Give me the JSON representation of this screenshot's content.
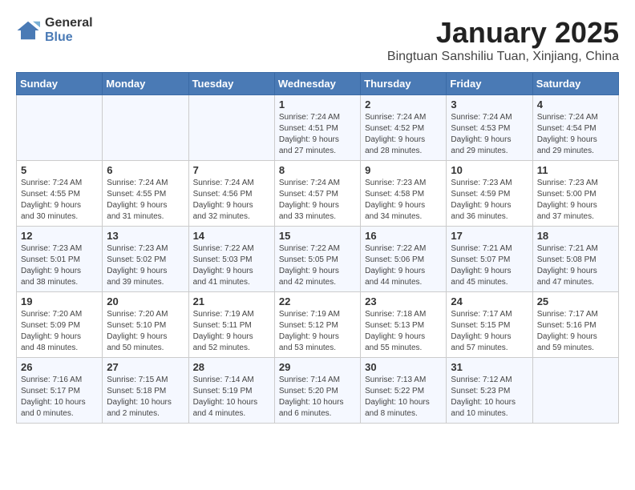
{
  "logo": {
    "general": "General",
    "blue": "Blue"
  },
  "header": {
    "title": "January 2025",
    "subtitle": "Bingtuan Sanshiliu Tuan, Xinjiang, China"
  },
  "days_of_week": [
    "Sunday",
    "Monday",
    "Tuesday",
    "Wednesday",
    "Thursday",
    "Friday",
    "Saturday"
  ],
  "weeks": [
    {
      "days": [
        {
          "number": "",
          "info": ""
        },
        {
          "number": "",
          "info": ""
        },
        {
          "number": "",
          "info": ""
        },
        {
          "number": "1",
          "info": "Sunrise: 7:24 AM\nSunset: 4:51 PM\nDaylight: 9 hours\nand 27 minutes."
        },
        {
          "number": "2",
          "info": "Sunrise: 7:24 AM\nSunset: 4:52 PM\nDaylight: 9 hours\nand 28 minutes."
        },
        {
          "number": "3",
          "info": "Sunrise: 7:24 AM\nSunset: 4:53 PM\nDaylight: 9 hours\nand 29 minutes."
        },
        {
          "number": "4",
          "info": "Sunrise: 7:24 AM\nSunset: 4:54 PM\nDaylight: 9 hours\nand 29 minutes."
        }
      ]
    },
    {
      "days": [
        {
          "number": "5",
          "info": "Sunrise: 7:24 AM\nSunset: 4:55 PM\nDaylight: 9 hours\nand 30 minutes."
        },
        {
          "number": "6",
          "info": "Sunrise: 7:24 AM\nSunset: 4:55 PM\nDaylight: 9 hours\nand 31 minutes."
        },
        {
          "number": "7",
          "info": "Sunrise: 7:24 AM\nSunset: 4:56 PM\nDaylight: 9 hours\nand 32 minutes."
        },
        {
          "number": "8",
          "info": "Sunrise: 7:24 AM\nSunset: 4:57 PM\nDaylight: 9 hours\nand 33 minutes."
        },
        {
          "number": "9",
          "info": "Sunrise: 7:23 AM\nSunset: 4:58 PM\nDaylight: 9 hours\nand 34 minutes."
        },
        {
          "number": "10",
          "info": "Sunrise: 7:23 AM\nSunset: 4:59 PM\nDaylight: 9 hours\nand 36 minutes."
        },
        {
          "number": "11",
          "info": "Sunrise: 7:23 AM\nSunset: 5:00 PM\nDaylight: 9 hours\nand 37 minutes."
        }
      ]
    },
    {
      "days": [
        {
          "number": "12",
          "info": "Sunrise: 7:23 AM\nSunset: 5:01 PM\nDaylight: 9 hours\nand 38 minutes."
        },
        {
          "number": "13",
          "info": "Sunrise: 7:23 AM\nSunset: 5:02 PM\nDaylight: 9 hours\nand 39 minutes."
        },
        {
          "number": "14",
          "info": "Sunrise: 7:22 AM\nSunset: 5:03 PM\nDaylight: 9 hours\nand 41 minutes."
        },
        {
          "number": "15",
          "info": "Sunrise: 7:22 AM\nSunset: 5:05 PM\nDaylight: 9 hours\nand 42 minutes."
        },
        {
          "number": "16",
          "info": "Sunrise: 7:22 AM\nSunset: 5:06 PM\nDaylight: 9 hours\nand 44 minutes."
        },
        {
          "number": "17",
          "info": "Sunrise: 7:21 AM\nSunset: 5:07 PM\nDaylight: 9 hours\nand 45 minutes."
        },
        {
          "number": "18",
          "info": "Sunrise: 7:21 AM\nSunset: 5:08 PM\nDaylight: 9 hours\nand 47 minutes."
        }
      ]
    },
    {
      "days": [
        {
          "number": "19",
          "info": "Sunrise: 7:20 AM\nSunset: 5:09 PM\nDaylight: 9 hours\nand 48 minutes."
        },
        {
          "number": "20",
          "info": "Sunrise: 7:20 AM\nSunset: 5:10 PM\nDaylight: 9 hours\nand 50 minutes."
        },
        {
          "number": "21",
          "info": "Sunrise: 7:19 AM\nSunset: 5:11 PM\nDaylight: 9 hours\nand 52 minutes."
        },
        {
          "number": "22",
          "info": "Sunrise: 7:19 AM\nSunset: 5:12 PM\nDaylight: 9 hours\nand 53 minutes."
        },
        {
          "number": "23",
          "info": "Sunrise: 7:18 AM\nSunset: 5:13 PM\nDaylight: 9 hours\nand 55 minutes."
        },
        {
          "number": "24",
          "info": "Sunrise: 7:17 AM\nSunset: 5:15 PM\nDaylight: 9 hours\nand 57 minutes."
        },
        {
          "number": "25",
          "info": "Sunrise: 7:17 AM\nSunset: 5:16 PM\nDaylight: 9 hours\nand 59 minutes."
        }
      ]
    },
    {
      "days": [
        {
          "number": "26",
          "info": "Sunrise: 7:16 AM\nSunset: 5:17 PM\nDaylight: 10 hours\nand 0 minutes."
        },
        {
          "number": "27",
          "info": "Sunrise: 7:15 AM\nSunset: 5:18 PM\nDaylight: 10 hours\nand 2 minutes."
        },
        {
          "number": "28",
          "info": "Sunrise: 7:14 AM\nSunset: 5:19 PM\nDaylight: 10 hours\nand 4 minutes."
        },
        {
          "number": "29",
          "info": "Sunrise: 7:14 AM\nSunset: 5:20 PM\nDaylight: 10 hours\nand 6 minutes."
        },
        {
          "number": "30",
          "info": "Sunrise: 7:13 AM\nSunset: 5:22 PM\nDaylight: 10 hours\nand 8 minutes."
        },
        {
          "number": "31",
          "info": "Sunrise: 7:12 AM\nSunset: 5:23 PM\nDaylight: 10 hours\nand 10 minutes."
        },
        {
          "number": "",
          "info": ""
        }
      ]
    }
  ]
}
